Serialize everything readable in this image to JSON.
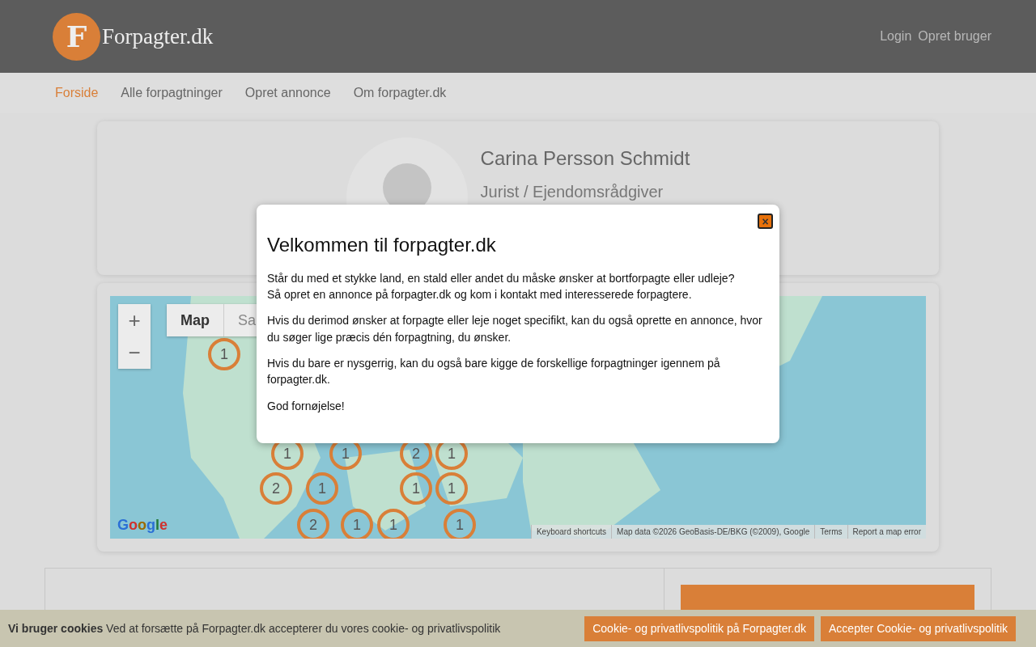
{
  "header": {
    "logo_letter": "F",
    "logo_text": "Forpagter.dk",
    "links": [
      "Login",
      "Opret bruger"
    ]
  },
  "nav": [
    {
      "label": "Forside",
      "selected": true
    },
    {
      "label": "Alle forpagtninger",
      "selected": false
    },
    {
      "label": "Opret annonce",
      "selected": false
    },
    {
      "label": "Om forpagter.dk",
      "selected": false
    }
  ],
  "profile": {
    "name": "Carina Persson Schmidt",
    "title": "Jurist / Ejendomsrådgiver"
  },
  "map": {
    "map_types": [
      "Map",
      "Sa"
    ],
    "zoom": [
      "+",
      "−"
    ],
    "clusters": [
      {
        "count": "1"
      },
      {
        "count": "1"
      },
      {
        "count": "1"
      },
      {
        "count": "2"
      },
      {
        "count": "1"
      },
      {
        "count": "2"
      },
      {
        "count": "1"
      },
      {
        "count": "1"
      },
      {
        "count": "1"
      },
      {
        "count": "2"
      },
      {
        "count": "1"
      },
      {
        "count": "1"
      },
      {
        "count": "1"
      }
    ],
    "logo": "Google",
    "attribution": [
      "Keyboard shortcuts",
      "Map data ©2026 GeoBasis-DE/BKG (©2009), Google",
      "Terms",
      "Report a map error"
    ]
  },
  "modal": {
    "close": "×",
    "title": "Velkommen til forpagter.dk",
    "paragraphs": [
      "Står du med et stykke land, en stald eller andet du måske ønsker at bortforpagte eller udleje?\nSå opret en annonce på forpagter.dk og kom i kontakt med interesserede forpagtere.",
      "Hvis du derimod ønsker at forpagte eller leje noget specifikt, kan du også oprette en annonce, hvor du søger lige præcis dén forpagtning, du ønsker.",
      "Hvis du bare er nysgerrig, kan du også bare kigge de forskellige forpagtninger igennem på forpagter.dk.",
      "God fornøjelse!"
    ]
  },
  "cookie": {
    "bold": "Vi bruger cookies",
    "text": "Ved at forsætte på Forpagter.dk accepterer du vores cookie- og privatlivspolitik",
    "buttons": [
      "Cookie- og privatlivspolitik på Forpagter.dk",
      "Accepter Cookie- og privatlivspolitik"
    ]
  }
}
